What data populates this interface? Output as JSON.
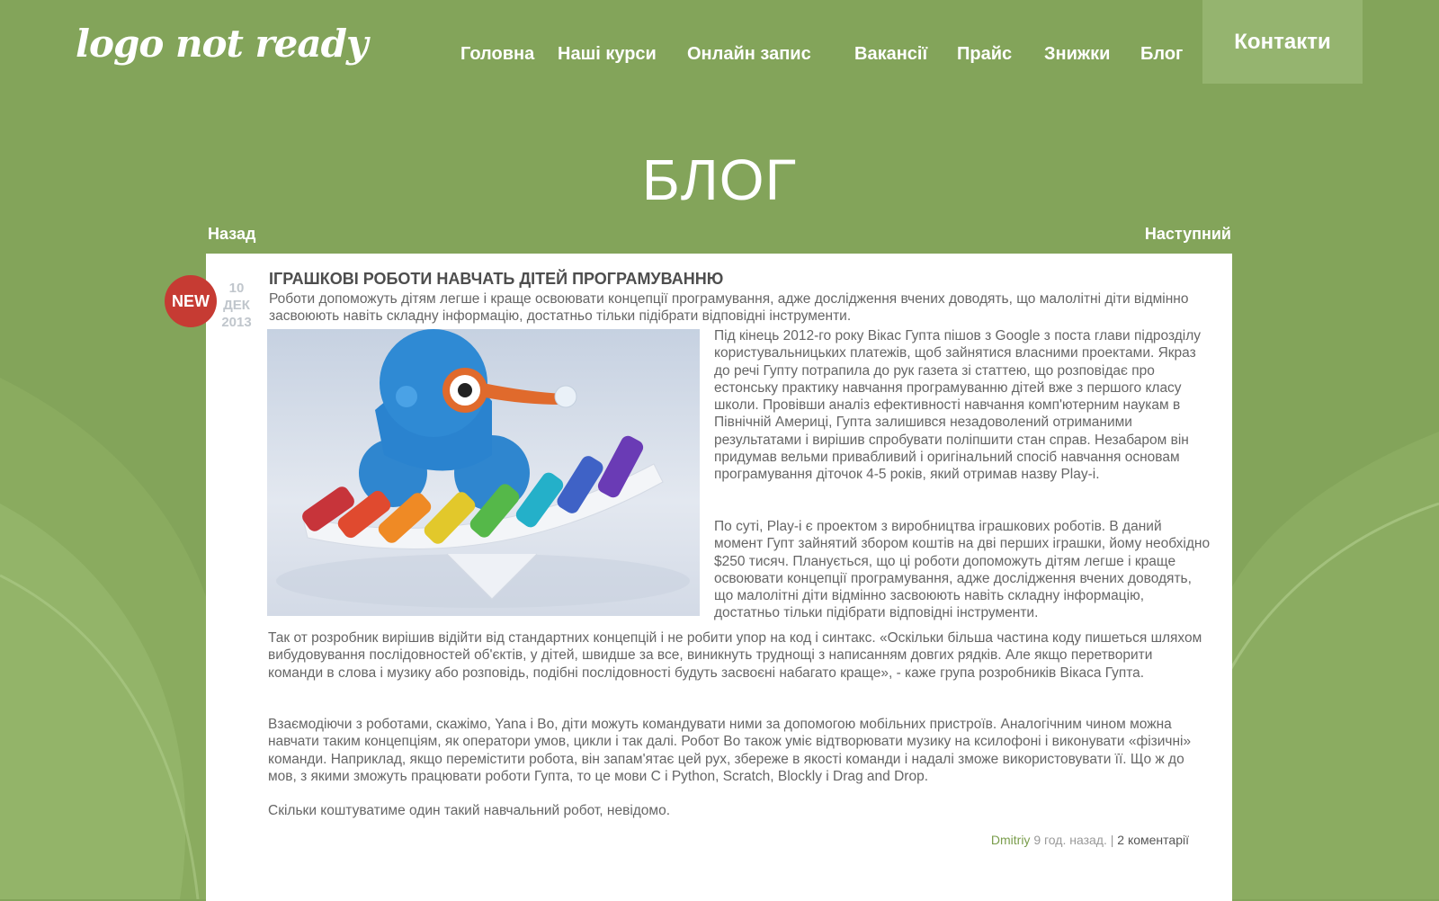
{
  "header": {
    "logo": "logo not ready",
    "nav": [
      "Головна",
      "Наші курси",
      "Онлайн запис",
      "Вакансії",
      "Прайс",
      "Знижки",
      "Блог"
    ],
    "contacts": "Контакти"
  },
  "page_title": "БЛОГ",
  "pager": {
    "prev": "Назад",
    "next": "Наступний"
  },
  "post": {
    "badge": "NEW",
    "date": {
      "day": "10",
      "month": "ДЕК",
      "year": "2013"
    },
    "title": "ІГРАШКОВІ РОБОТИ НАВЧАТЬ ДІТЕЙ ПРОГРАМУВАННЮ",
    "lead": "Роботи допоможуть дітям легше і краще освоювати концепції програмування, адже дослідження вчених доводять, що малолітні діти відмінно засвоюють навіть складну інформацію, достатньо тільки підібрати відповідні інструменти.",
    "p1": "Під кінець 2012-го року Вікас Гупта пішов з Google з поста глави підрозділу користувальницьких платежів, щоб зайнятися власними проектами. Якраз до речі Гупту потрапила до рук газета зі статтею, що розповідає про естонську практику навчання програмуванню дітей вже з першого класу школи. Провівши аналіз ефективності навчання комп'ютерним наукам в Північній Америці, Гупта залишився незадоволений отриманими результатами і вирішив спробувати поліпшити стан справ. Незабаром він придумав вельми привабливий і оригінальний спосіб навчання основам програмування діточок 4-5 років, який отримав назву Play-i.",
    "p2": "По суті, Play-i є проектом з виробництва іграшкових роботів. В даний момент Гупт зайнятий збором коштів на дві перших іграшки, йому необхідно $250 тисяч. Планується, що ці роботи допоможуть дітям легше і краще освоювати концепції програмування, адже дослідження вчених доводять, що малолітні діти відмінно засвоюють навіть складну інформацію, достатньо тільки підібрати відповідні інструменти.",
    "p3": "Так от розробник вирішив відійти від стандартних концепцій і не робити упор на код і синтакс. «Оскільки більша частина коду пишеться шляхом вибудовування послідовностей об'єктів, у дітей, швидше за все, виникнуть труднощі з написанням довгих рядків. Але якщо перетворити команди в слова і музику або розповідь, подібні послідовності будуть засвоєні набагато краще», - каже група розробників Вікаса Гупта.",
    "p4": "Взаємодіючи з роботами, скажімо, Yana і Bo, діти можуть командувати ними за допомогою мобільних пристроїв. Аналогічним чином можна навчати таким концепціям, як оператори умов, цикли і так далі. Робот Bo також уміє відтворювати музику на ксилофоні і виконувати «фізичні» команди. Наприклад, якщо перемістити робота, він запам'ятає цей рух, збереже в якості команди і надалі зможе використовувати її. Що ж до мов, з якими зможуть працювати роботи Гупта, то це мови C і Python, Scratch, Blockly і Drag and Drop.",
    "p5": "Скільки коштуватиме один такий навчальний робот, невідомо.",
    "author": "Dmitriy",
    "time_ago": "9 год. назад.",
    "separator": "|",
    "comments": "2 коментарії"
  },
  "colors": {
    "background": "#83a45a",
    "badge": "#c63b33",
    "contacts_bg": "#95b46f",
    "author": "#7a9d4c"
  }
}
